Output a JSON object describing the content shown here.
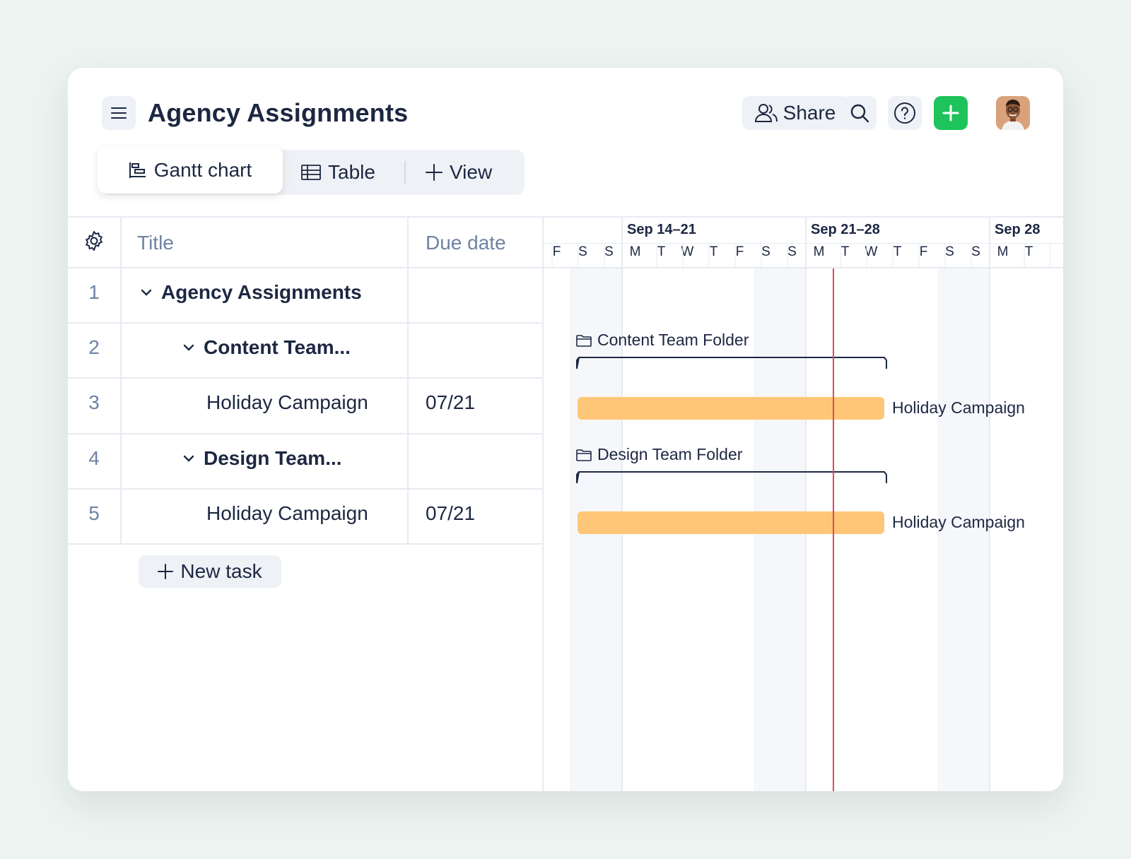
{
  "header": {
    "title": "Agency Assignments",
    "share_label": "Share"
  },
  "views": {
    "gantt_label": "Gantt chart",
    "table_label": "Table",
    "add_view_label": "View"
  },
  "table": {
    "columns": {
      "title": "Title",
      "due": "Due date"
    },
    "rows": [
      {
        "num": "1",
        "title": "Agency Assignments",
        "due": ""
      },
      {
        "num": "2",
        "title": "Content Team...",
        "due": ""
      },
      {
        "num": "3",
        "title": "Holiday Campaign",
        "due": "07/21"
      },
      {
        "num": "4",
        "title": "Design Team...",
        "due": ""
      },
      {
        "num": "5",
        "title": "Holiday Campaign",
        "due": "07/21"
      }
    ],
    "new_task_label": "New task"
  },
  "gantt": {
    "weeks": [
      "Sep 14–21",
      "Sep 21–28",
      "Sep 28"
    ],
    "days": [
      "F",
      "S",
      "S",
      "M",
      "T",
      "W",
      "T",
      "F",
      "S",
      "S",
      "M",
      "T",
      "W",
      "T",
      "F",
      "S",
      "S",
      "M",
      "T"
    ],
    "folders": [
      {
        "label": "Content Team Folder"
      },
      {
        "label": "Design Team Folder"
      }
    ],
    "tasks": [
      {
        "label": "Holiday Campaign"
      },
      {
        "label": "Holiday Campaign"
      }
    ],
    "today_color": "#e0485a",
    "task_color": "#ffc677"
  },
  "colors": {
    "add_button": "#1ec45b",
    "background": "#ecf3f1"
  }
}
